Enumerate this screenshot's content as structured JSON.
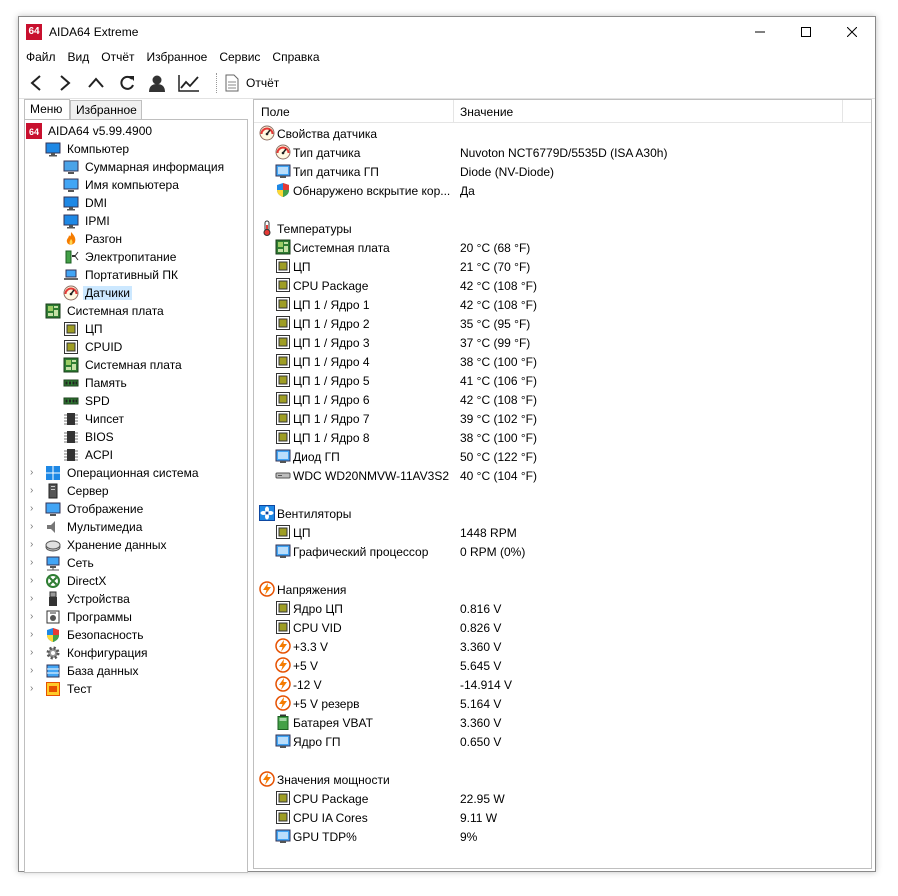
{
  "window": {
    "title": "AIDA64 Extreme",
    "app_icon_text": "64"
  },
  "menu": [
    "Файл",
    "Вид",
    "Отчёт",
    "Избранное",
    "Сервис",
    "Справка"
  ],
  "toolbar": {
    "report_label": "Отчёт"
  },
  "tabs": {
    "menu": "Меню",
    "favorites": "Избранное"
  },
  "tree": {
    "root": "AIDA64 v5.99.4900",
    "computer": {
      "label": "Компьютер",
      "children": [
        "Суммарная информация",
        "Имя компьютера",
        "DMI",
        "IPMI",
        "Разгон",
        "Электропитание",
        "Портативный ПК",
        "Датчики"
      ]
    },
    "motherboard": {
      "label": "Системная плата",
      "children": [
        "ЦП",
        "CPUID",
        "Системная плата",
        "Память",
        "SPD",
        "Чипсет",
        "BIOS",
        "ACPI"
      ]
    },
    "collapsed": [
      "Операционная система",
      "Сервер",
      "Отображение",
      "Мультимедиа",
      "Хранение данных",
      "Сеть",
      "DirectX",
      "Устройства",
      "Программы",
      "Безопасность",
      "Конфигурация",
      "База данных",
      "Тест"
    ],
    "selected": "Датчики"
  },
  "columns": {
    "field": "Поле",
    "value": "Значение"
  },
  "sections": [
    {
      "title": "Свойства датчика",
      "icon": "gauge-icon",
      "rows": [
        {
          "field": "Тип датчика",
          "value": "Nuvoton NCT6779D/5535D  (ISA A30h)",
          "icon": "gauge-icon"
        },
        {
          "field": "Тип датчика ГП",
          "value": "Diode  (NV-Diode)",
          "icon": "gpu-icon"
        },
        {
          "field": "Обнаружено вскрытие кор...",
          "value": "Да",
          "icon": "shield-icon"
        }
      ]
    },
    {
      "title": "Температуры",
      "icon": "thermometer-icon",
      "rows": [
        {
          "field": "Системная плата",
          "value": "20 °C  (68 °F)",
          "icon": "motherboard-icon"
        },
        {
          "field": "ЦП",
          "value": "21 °C  (70 °F)",
          "icon": "cpu-icon"
        },
        {
          "field": "CPU Package",
          "value": "42 °C  (108 °F)",
          "icon": "cpu-icon"
        },
        {
          "field": "ЦП 1 / Ядро 1",
          "value": "42 °C  (108 °F)",
          "icon": "cpu-icon"
        },
        {
          "field": "ЦП 1 / Ядро 2",
          "value": "35 °C  (95 °F)",
          "icon": "cpu-icon"
        },
        {
          "field": "ЦП 1 / Ядро 3",
          "value": "37 °C  (99 °F)",
          "icon": "cpu-icon"
        },
        {
          "field": "ЦП 1 / Ядро 4",
          "value": "38 °C  (100 °F)",
          "icon": "cpu-icon"
        },
        {
          "field": "ЦП 1 / Ядро 5",
          "value": "41 °C  (106 °F)",
          "icon": "cpu-icon"
        },
        {
          "field": "ЦП 1 / Ядро 6",
          "value": "42 °C  (108 °F)",
          "icon": "cpu-icon"
        },
        {
          "field": "ЦП 1 / Ядро 7",
          "value": "39 °C  (102 °F)",
          "icon": "cpu-icon"
        },
        {
          "field": "ЦП 1 / Ядро 8",
          "value": "38 °C  (100 °F)",
          "icon": "cpu-icon"
        },
        {
          "field": "Диод ГП",
          "value": "50 °C  (122 °F)",
          "icon": "gpu-icon"
        },
        {
          "field": "WDC WD20NMVW-11AV3S2",
          "value": "40 °C  (104 °F)",
          "icon": "hdd-icon"
        }
      ]
    },
    {
      "title": "Вентиляторы",
      "icon": "fan-icon",
      "rows": [
        {
          "field": "ЦП",
          "value": "1448 RPM",
          "icon": "cpu-icon"
        },
        {
          "field": "Графический процессор",
          "value": "0 RPM  (0%)",
          "icon": "gpu-icon"
        }
      ]
    },
    {
      "title": "Напряжения",
      "icon": "voltage-icon",
      "rows": [
        {
          "field": "Ядро ЦП",
          "value": "0.816 V",
          "icon": "cpu-icon"
        },
        {
          "field": "CPU VID",
          "value": "0.826 V",
          "icon": "cpu-icon"
        },
        {
          "field": "+3.3 V",
          "value": "3.360 V",
          "icon": "voltage-icon"
        },
        {
          "field": "+5 V",
          "value": "5.645 V",
          "icon": "voltage-icon"
        },
        {
          "field": "-12 V",
          "value": "-14.914 V",
          "icon": "voltage-icon"
        },
        {
          "field": "+5 V резерв",
          "value": "5.164 V",
          "icon": "voltage-icon"
        },
        {
          "field": "Батарея VBAT",
          "value": "3.360 V",
          "icon": "battery-icon"
        },
        {
          "field": "Ядро ГП",
          "value": "0.650 V",
          "icon": "gpu-icon"
        }
      ]
    },
    {
      "title": "Значения мощности",
      "icon": "voltage-icon",
      "rows": [
        {
          "field": "CPU Package",
          "value": "22.95 W",
          "icon": "cpu-icon"
        },
        {
          "field": "CPU IA Cores",
          "value": "9.11 W",
          "icon": "cpu-icon"
        },
        {
          "field": "GPU TDP%",
          "value": "9%",
          "icon": "gpu-icon"
        }
      ]
    }
  ]
}
